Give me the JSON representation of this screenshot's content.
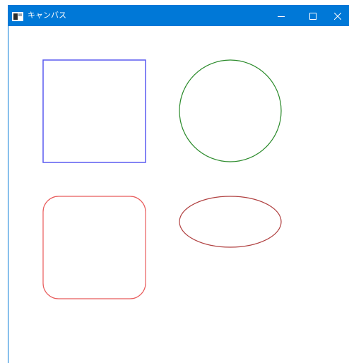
{
  "window": {
    "title": "キャンバス",
    "titlebar_color": "#0078d7",
    "icons": {
      "app": "window-app-icon",
      "minimize": "minimize-icon",
      "maximize": "maximize-icon",
      "close": "close-icon"
    }
  },
  "canvas": {
    "background": "#ffffff",
    "shapes": [
      {
        "name": "square",
        "stroke": "#5a5af0"
      },
      {
        "name": "circle",
        "stroke": "#2a8a2a"
      },
      {
        "name": "rounded-rectangle",
        "stroke": "#e85a5a"
      },
      {
        "name": "ellipse",
        "stroke": "#b04040"
      }
    ]
  }
}
